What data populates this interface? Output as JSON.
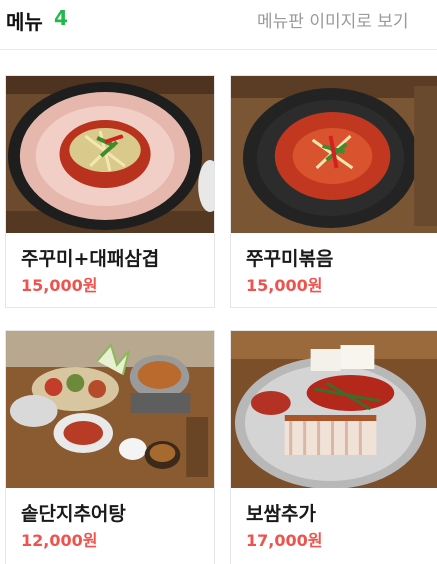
{
  "header": {
    "title": "메뉴",
    "count": "4",
    "view_menu_image_link": "메뉴판 이미지로 보기"
  },
  "colors": {
    "accent_green": "#1fb94a",
    "price_red": "#f0524d",
    "muted_gray": "#9a9a9a"
  },
  "menu": {
    "items": [
      {
        "name": "주꾸미+대패삼겹",
        "price": "15,000원"
      },
      {
        "name": "쭈꾸미볶음",
        "price": "15,000원"
      },
      {
        "name": "솥단지추어탕",
        "price": "12,000원"
      },
      {
        "name": "보쌈추가",
        "price": "17,000원"
      }
    ]
  }
}
